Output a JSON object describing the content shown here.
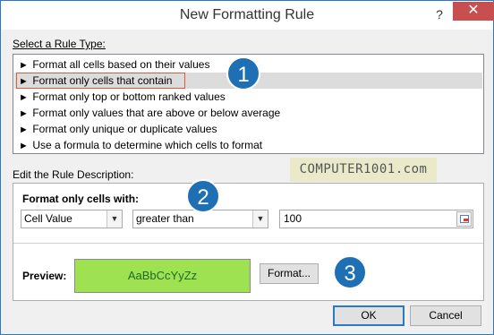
{
  "window": {
    "title": "New Formatting Rule",
    "help_label": "?",
    "close_label": "✕"
  },
  "rule_type": {
    "label": "Select a Rule Type:",
    "items": [
      {
        "label": "Format all cells based on their values",
        "selected": false
      },
      {
        "label": "Format only cells that contain",
        "selected": true
      },
      {
        "label": "Format only top or bottom ranked values",
        "selected": false
      },
      {
        "label": "Format only values that are above or below average",
        "selected": false
      },
      {
        "label": "Format only unique or duplicate values",
        "selected": false
      },
      {
        "label": "Use a formula to determine which cells to format",
        "selected": false
      }
    ],
    "arrow_glyph": "►"
  },
  "badges": [
    "1",
    "2",
    "3"
  ],
  "watermark": "COMPUTER1001.com",
  "description": {
    "label": "Edit the Rule Description:",
    "format_only_label": "Format only cells with:",
    "condition_field": "Cell Value",
    "operator": "greater than",
    "value": "100",
    "preview_label": "Preview:",
    "preview_sample": "AaBbCcYyZz",
    "format_button": "Format..."
  },
  "buttons": {
    "ok": "OK",
    "cancel": "Cancel"
  },
  "colors": {
    "accent": "#2b78c6",
    "close": "#c74f50",
    "badge": "#1f6fb5",
    "preview_fill": "#9ee251",
    "selection_outline": "#e2583b"
  }
}
